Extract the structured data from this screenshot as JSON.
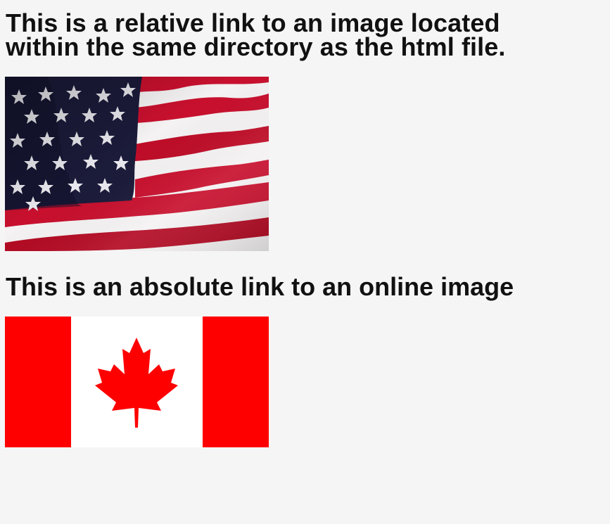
{
  "headings": {
    "relative": "This is a relative link to an image located within the same directory as the html file.",
    "absolute": "This is an absolute link to an online image"
  },
  "images": {
    "us_flag": {
      "icon": "american-flag-image",
      "colors": {
        "red": "#c8102e",
        "white": "#f4f2f2",
        "blue": "#1b1b3a"
      }
    },
    "canada_flag": {
      "icon": "canadian-flag-image",
      "colors": {
        "red": "#ff0000",
        "white": "#ffffff"
      }
    }
  }
}
